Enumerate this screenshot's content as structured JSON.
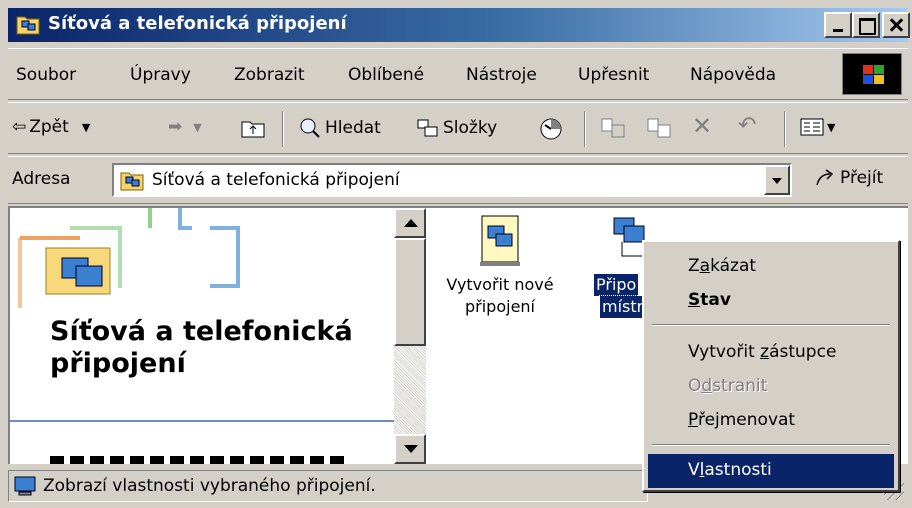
{
  "window": {
    "title": "Síťová a telefonická připojení"
  },
  "menubar": {
    "items": [
      "Soubor",
      "Úpravy",
      "Zobrazit",
      "Oblíbené",
      "Nástroje",
      "Upřesnit",
      "Nápověda"
    ]
  },
  "toolbar": {
    "back_label": "Zpět",
    "search_label": "Hledat",
    "folders_label": "Složky"
  },
  "address": {
    "label": "Adresa",
    "value": "Síťová a telefonická připojení",
    "go_label": "Přejít"
  },
  "left_pane": {
    "title": "Síťová a telefonická připojení"
  },
  "icons": [
    {
      "label_line1": "Vytvořit nové",
      "label_line2": "připojení"
    },
    {
      "label_line1": "Připo",
      "label_line2": "místr"
    }
  ],
  "context_menu": {
    "items": [
      {
        "pre": "Z",
        "key": "a",
        "post": "kázat",
        "state": "normal"
      },
      {
        "pre": "",
        "key": "S",
        "post": "tav",
        "state": "default"
      },
      {
        "pre": "Vytvořit ",
        "key": "z",
        "post": "ástupce",
        "state": "normal"
      },
      {
        "pre": "O",
        "key": "d",
        "post": "stranit",
        "state": "disabled"
      },
      {
        "pre": "",
        "key": "P",
        "post": "řejmenovat",
        "state": "normal"
      },
      {
        "pre": "V",
        "key": "l",
        "post": "astnosti",
        "state": "highlighted"
      }
    ]
  },
  "statusbar": {
    "text": "Zobrazí vlastnosti vybraného připojení."
  },
  "colors": {
    "titlebar_start": "#0a246a",
    "titlebar_end": "#a6caf0",
    "face": "#d4d0c8",
    "highlight": "#0a246a"
  }
}
